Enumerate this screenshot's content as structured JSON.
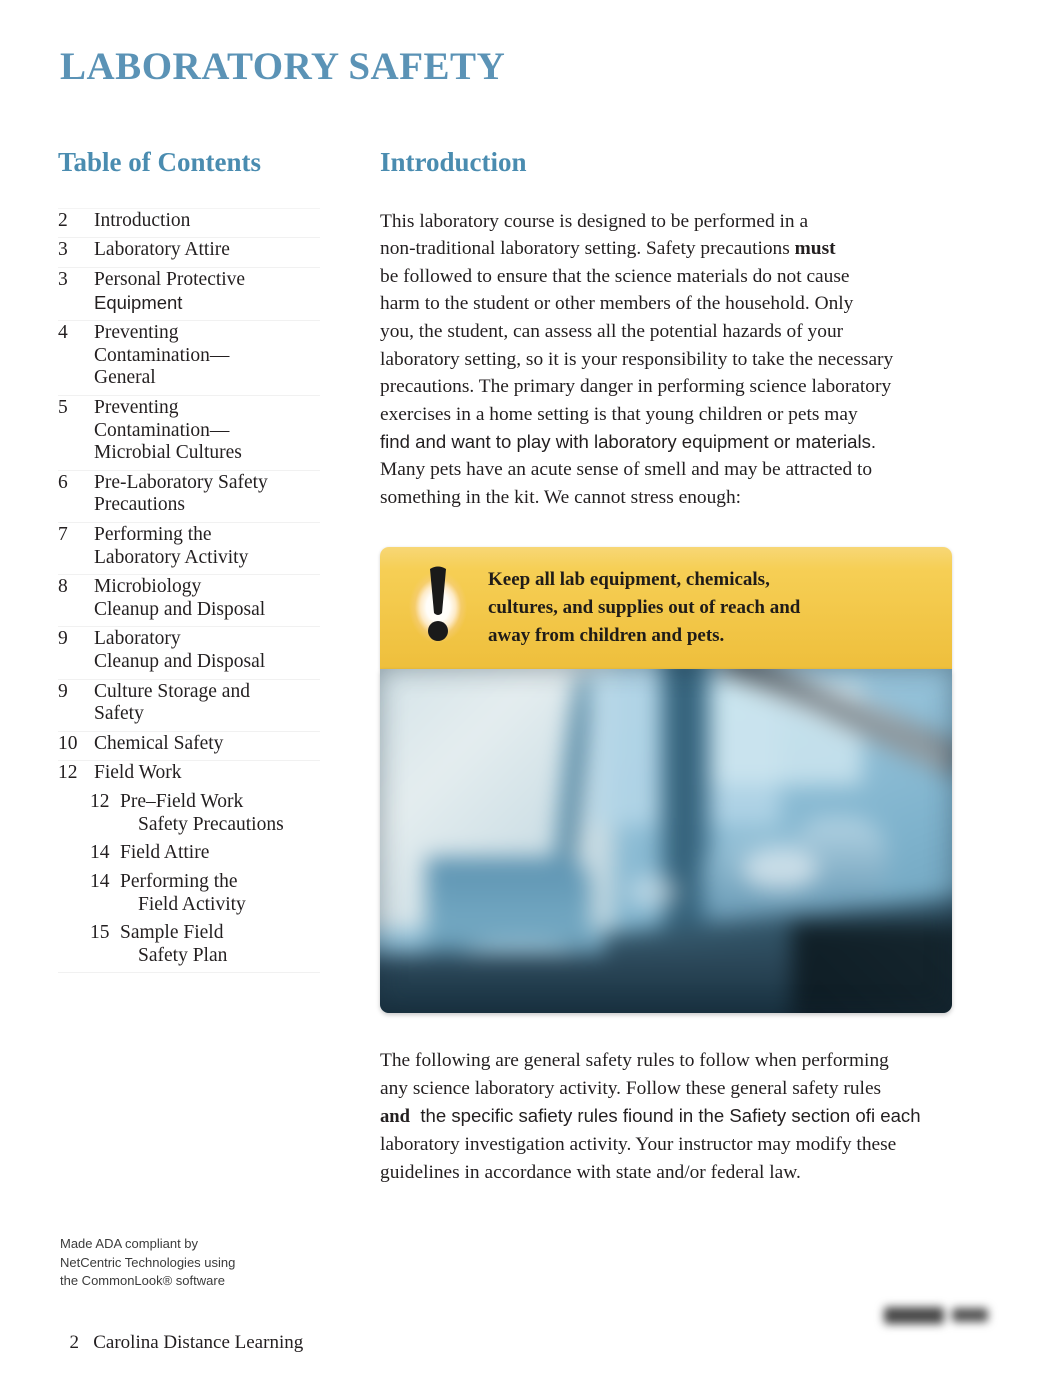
{
  "document": {
    "title": "LABORATORY SAFETY",
    "accent_color": "#5b93b6",
    "heading_color": "#4a8cb0"
  },
  "toc": {
    "heading": "Table of Contents",
    "entries": [
      {
        "page": "2",
        "label": "Introduction"
      },
      {
        "page": "3",
        "label": "Laboratory Attire"
      },
      {
        "page": "3",
        "label": "Personal Protective",
        "label2": "Equipment"
      },
      {
        "page": "4",
        "label": "Preventing",
        "label2": "Contamination—",
        "label3": "General"
      },
      {
        "page": "5",
        "label": "Preventing",
        "label2": "Contamination—",
        "label3": "Microbial Cultures"
      },
      {
        "page": "6",
        "label": "Pre-Laboratory Safety",
        "label2": "Precautions"
      },
      {
        "page": "7",
        "label": "Performing the",
        "label2": "Laboratory Activity"
      },
      {
        "page": "8",
        "label": "Microbiology",
        "label2": "Cleanup and Disposal"
      },
      {
        "page": "9",
        "label": "Laboratory",
        "label2": "Cleanup and Disposal"
      },
      {
        "page": "9",
        "label": "Culture Storage and",
        "label2": "Safety"
      },
      {
        "page": "10",
        "label": "Chemical  Safety"
      },
      {
        "page": "12",
        "label": "Field  Work"
      }
    ],
    "sub_entries": [
      {
        "page": "12",
        "label": "Pre–Field  Work",
        "label2": "Safety Precautions"
      },
      {
        "page": "14",
        "label": "Field  Attire"
      },
      {
        "page": "14",
        "label": "Performing  the",
        "label2": "Field Activity"
      },
      {
        "page": "15",
        "label": "Sample  Field",
        "label2": "Safety Plan"
      }
    ]
  },
  "introduction": {
    "heading": "Introduction",
    "paragraph1_lines": [
      {
        "text": "This laboratory course is designed to be performed in a",
        "style": "serif"
      },
      {
        "text": "non-traditional laboratory setting. Safety precautions ",
        "bold_tail": "must",
        "style": "serif"
      },
      {
        "text": "be followed to ensure that the science materials do not cause",
        "style": "serif"
      },
      {
        "text": "harm to the student or other members of the household. Only",
        "style": "serif"
      },
      {
        "text": "you, the student, can assess all the potential hazards of your",
        "style": "serif"
      },
      {
        "text": "laboratory setting, so it is your responsibility to take the necessary",
        "style": "serif"
      },
      {
        "text": "precautions. The primary danger in performing science laboratory",
        "style": "serif"
      },
      {
        "text": "exercises in a home setting is that young children or pets may",
        "style": "serif"
      },
      {
        "text": "find and want to play with laboratory equipment or materials.",
        "style": "sans"
      },
      {
        "text": "Many pets have an acute sense of smell and may be attracted to",
        "style": "serif"
      },
      {
        "text": "something in the kit. We cannot stress enough:",
        "style": "serif"
      }
    ],
    "paragraph2_lines": [
      {
        "text": "The following are general safety rules to follow when performing",
        "style": "serif"
      },
      {
        "text": "any science laboratory activity. Follow these general safety rules",
        "style": "serif"
      },
      {
        "bold_head": "and",
        "text": "  the specific safiety rules fiound in the Safiety section ofi each",
        "style": "sans"
      },
      {
        "text": "laboratory investigation activity. Your instructor may modify these",
        "style": "serif"
      },
      {
        "text": "guidelines in accordance with state and/or federal law.",
        "style": "serif"
      }
    ]
  },
  "callout": {
    "icon": "exclamation-warning-icon",
    "background_color": "#f2c647",
    "lines": [
      "Keep all lab equipment, chemicals,",
      "cultures, and supplies out of reach and",
      "away from children and pets."
    ]
  },
  "photo": {
    "alt": "blurred laboratory glassware and equipment in blue tones",
    "dominant_color": "#8fbdd4"
  },
  "footer": {
    "ada_lines": [
      "Made ADA compliant by",
      "NetCentric Technologies using",
      "the CommonLook® software"
    ],
    "page_number": "2",
    "publisher": "Carolina Distance Learning"
  }
}
